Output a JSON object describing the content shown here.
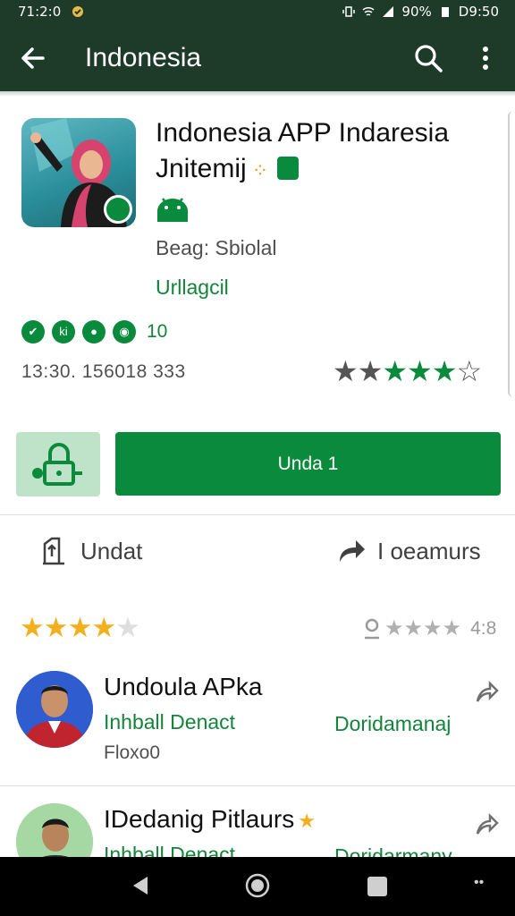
{
  "status_bar": {
    "time": "71:2:0",
    "battery": "90%",
    "clock": "D9:50"
  },
  "app_bar": {
    "title": "Indonesia"
  },
  "app": {
    "name_line1": "Indonesia APP Indaresia",
    "name_line2": "Jnitemij",
    "publisher": "Beag: Sbiolal",
    "category": "Urllagcil",
    "badges_count": "10",
    "downloads": "13:30. 156018 333",
    "rating_stars": "★★★★★☆"
  },
  "actions": {
    "install_label": "Unda 1",
    "left_label": "Undat",
    "right_label": "I oeamurs"
  },
  "rating_summary": {
    "stars": "★★★★★",
    "score": "4:8"
  },
  "reviews": [
    {
      "name": "Undoula APka",
      "subtitle": "Inhball Denact",
      "subtitle_right": "Doridamanaj",
      "meta": "Floxo0"
    },
    {
      "name": "IDedanig Pitlaurs",
      "subtitle": "Inhball Denact",
      "subtitle_right": "Doridarmany"
    }
  ],
  "colors": {
    "app_bar": "#1e3b2a",
    "accent": "#0a8a3c",
    "light_accent": "#bfe3c8",
    "star_gold": "#f2b01e"
  }
}
